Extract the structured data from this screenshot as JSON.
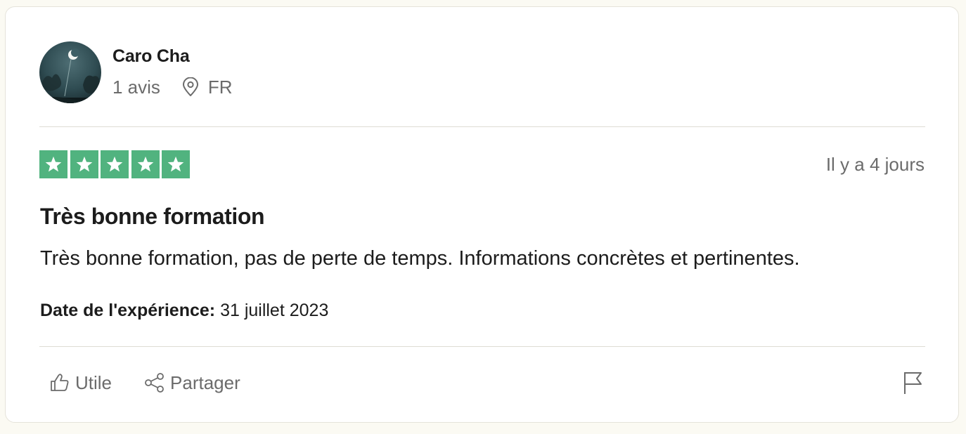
{
  "reviewer": {
    "name": "Caro Cha",
    "review_count": "1 avis",
    "country": "FR"
  },
  "review": {
    "rating": 5,
    "max_rating": 5,
    "date_relative": "Il y a 4 jours",
    "title": "Très bonne formation",
    "body": "Très bonne formation, pas de perte de temps. Informations concrètes et pertinentes.",
    "experience_label": "Date de l'expérience:",
    "experience_date": "31 juillet 2023"
  },
  "actions": {
    "useful_label": "Utile",
    "share_label": "Partager"
  },
  "colors": {
    "star_green": "#51b37f",
    "muted_text": "#6b6b6b",
    "background": "#fbfaf3"
  },
  "icons": [
    "avatar-image",
    "location-pin-icon",
    "star-icon",
    "thumbs-up-icon",
    "share-icon",
    "flag-icon"
  ]
}
